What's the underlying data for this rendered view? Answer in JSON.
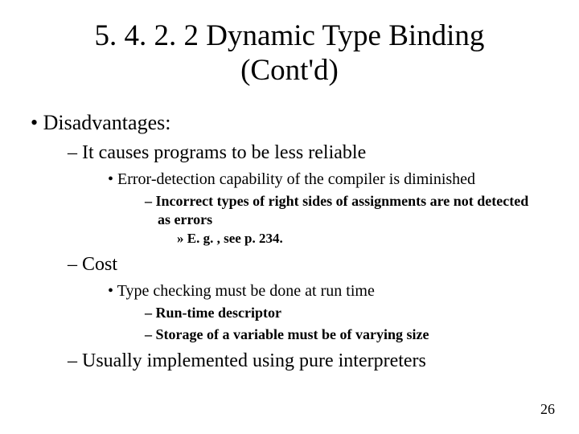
{
  "title_line1": "5. 4. 2. 2 Dynamic Type Binding",
  "title_line2": "(Cont'd)",
  "bullets": {
    "l1_disadvantages": "Disadvantages:",
    "l2_reliable": "It causes programs to be less reliable",
    "l3_error_detect": "Error-detection capability of the compiler is diminished",
    "l4_incorrect": "Incorrect types of right sides of assignments are not detected as errors",
    "l5_eg": "E. g. , see p. 234.",
    "l2_cost": "Cost",
    "l3_typecheck": "Type checking must be done at run time",
    "l4_descriptor": "Run-time descriptor",
    "l4_storage": "Storage of a variable must be of varying size",
    "l2_interp": "Usually implemented using pure interpreters"
  },
  "page_number": "26"
}
